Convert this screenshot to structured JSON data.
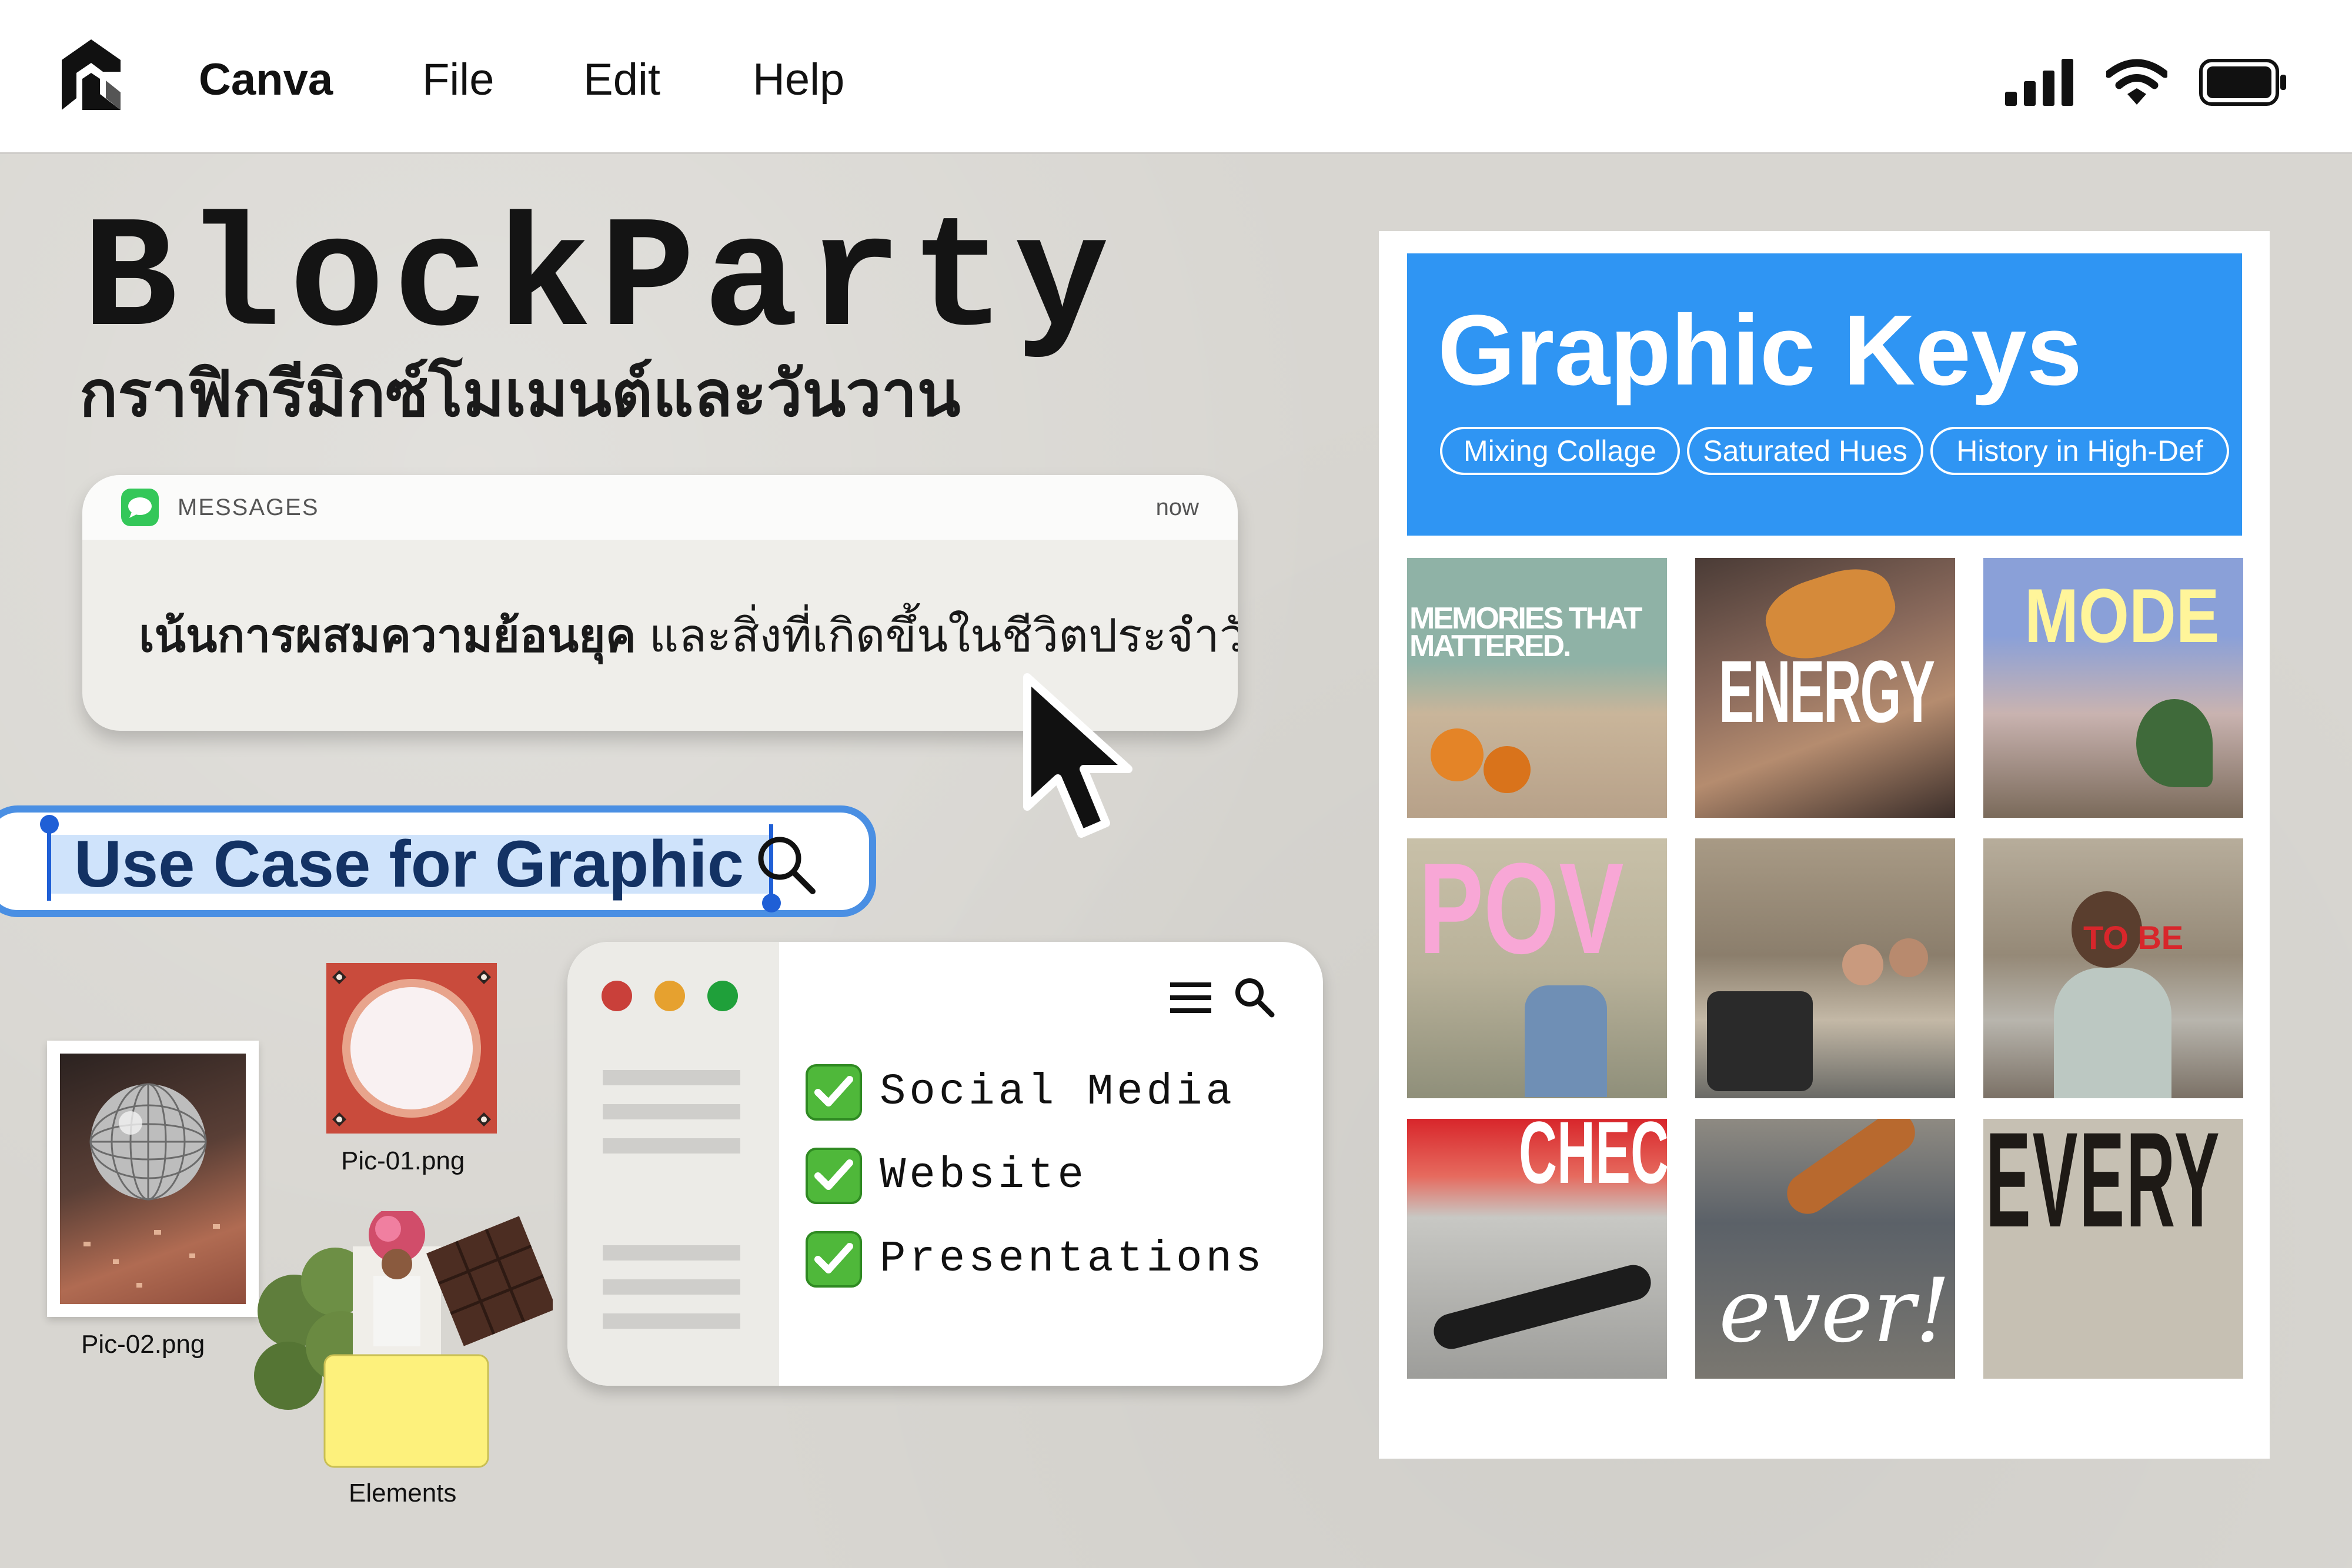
{
  "menubar": {
    "app_name": "Canva",
    "menus": [
      "File",
      "Edit",
      "Help"
    ],
    "status_icons": [
      "cellular-signal-icon",
      "wifi-icon",
      "battery-icon"
    ]
  },
  "header": {
    "title": "BlockParty",
    "subtitle": "กราฟิกรีมิกซ์โมเมนต์และวันวาน"
  },
  "notification": {
    "app": "MESSAGES",
    "time": "now",
    "message_bold": "เน้นการผสมความย้อนยุค",
    "message_rest": "และสิ่งที่เกิดขึ้นในชีวิตประจำวัน"
  },
  "search": {
    "value": "Use Case for Graphic"
  },
  "files": {
    "pic02": "Pic-02.png",
    "pic01": "Pic-01.png",
    "elements": "Elements"
  },
  "checklist": {
    "items": [
      "Social Media",
      "Website",
      "Presentations"
    ]
  },
  "graphic_keys": {
    "title": "Graphic Keys",
    "tags": [
      "Mixing Collage",
      "Saturated Hues",
      "History in High-Def"
    ],
    "tiles": [
      {
        "text": "MEMORIES THAT MATTERED."
      },
      {
        "text": "ENERGY"
      },
      {
        "text": "MODE"
      },
      {
        "text": "POV"
      },
      {
        "text": ""
      },
      {
        "text": "TO BE"
      },
      {
        "text": "CHECK"
      },
      {
        "text": "ever!"
      },
      {
        "text": "EVERY PI"
      }
    ]
  },
  "colors": {
    "accent_blue": "#2f95f3",
    "search_border": "#4a8fe3",
    "check_green": "#4fb83a",
    "sticky_yellow": "#fdf17c"
  }
}
